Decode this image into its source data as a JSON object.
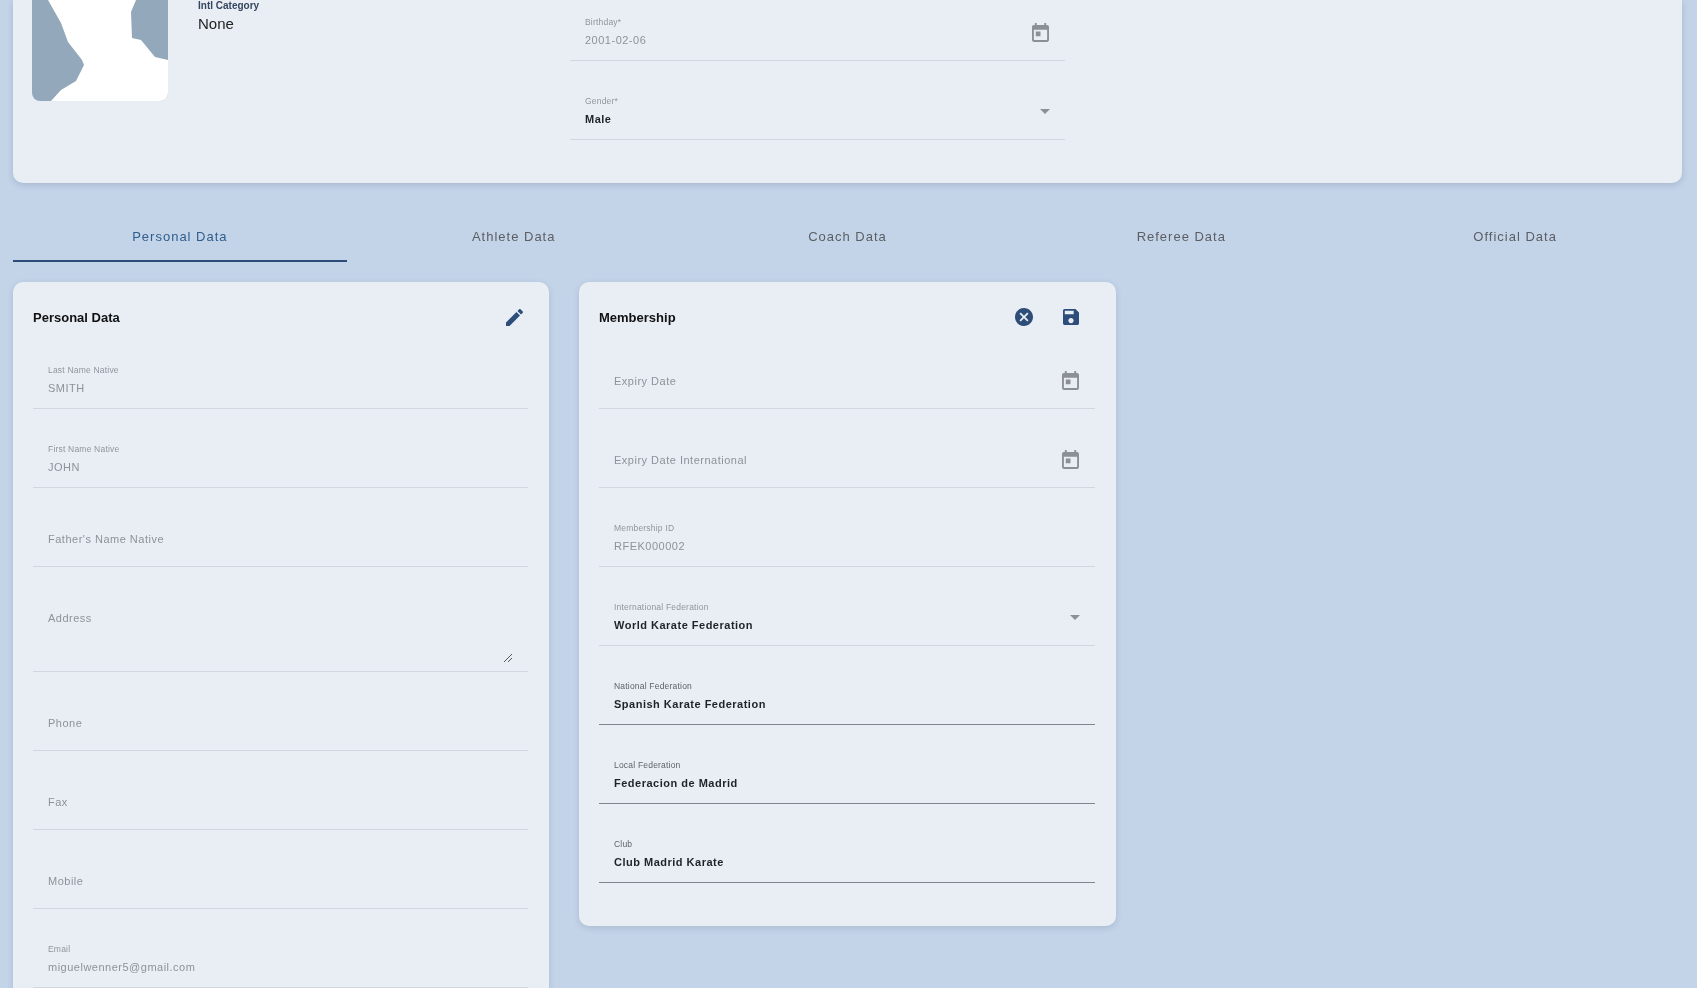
{
  "profile": {
    "category_label": "Intl Category",
    "category_value": "None",
    "fields": [
      {
        "kind": "date",
        "label": "Birthday*",
        "value": "2001-02-06",
        "disabled": true
      },
      {
        "kind": "select",
        "label": "Gender*",
        "value": "Male",
        "disabled": true
      }
    ]
  },
  "tabs": [
    {
      "label": "Personal Data",
      "selected": true
    },
    {
      "label": "Athlete Data",
      "selected": false
    },
    {
      "label": "Coach Data",
      "selected": false
    },
    {
      "label": "Referee Data",
      "selected": false
    },
    {
      "label": "Official Data",
      "selected": false
    }
  ],
  "personal_data": {
    "title": "Personal Data",
    "fields": [
      {
        "kind": "text",
        "label": "Last Name Native",
        "value": "SMITH",
        "disabled": true
      },
      {
        "kind": "text",
        "label": "First Name Native",
        "value": "JOHN",
        "disabled": true
      },
      {
        "kind": "text",
        "placeholder": "Father's Name Native",
        "disabled": true
      },
      {
        "kind": "textarea",
        "placeholder": "Address",
        "disabled": true
      },
      {
        "kind": "text",
        "placeholder": "Phone",
        "disabled": true
      },
      {
        "kind": "text",
        "placeholder": "Fax",
        "disabled": true
      },
      {
        "kind": "text",
        "placeholder": "Mobile",
        "disabled": true
      },
      {
        "kind": "text",
        "label": "Email",
        "value": "miguelwenner5@gmail.com",
        "disabled": true
      }
    ]
  },
  "membership": {
    "title": "Membership",
    "fields": [
      {
        "kind": "date",
        "placeholder": "Expiry Date",
        "disabled": true
      },
      {
        "kind": "date",
        "placeholder": "Expiry Date International",
        "disabled": true
      },
      {
        "kind": "text",
        "label": "Membership ID",
        "value": "RFEK000002",
        "disabled": true
      },
      {
        "kind": "select",
        "label": "International Federation",
        "value": "World Karate Federation",
        "disabled": true
      },
      {
        "kind": "text",
        "label": "National Federation",
        "value": "Spanish Karate Federation",
        "disabled": false
      },
      {
        "kind": "text",
        "label": "Local Federation",
        "value": "Federacion de Madrid",
        "disabled": false
      },
      {
        "kind": "text",
        "label": "Club",
        "value": "Club Madrid Karate",
        "disabled": false
      }
    ]
  }
}
